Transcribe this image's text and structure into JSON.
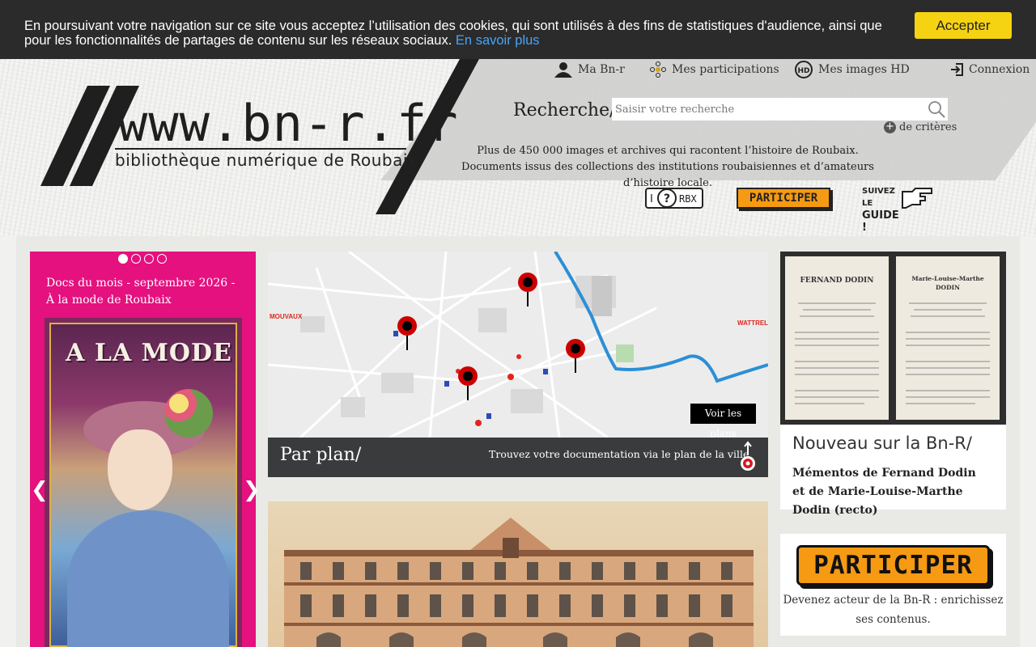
{
  "cookie": {
    "text": "En poursuivant votre navigation sur ce site vous acceptez l’utilisation des cookies, qui sont utilisés à des fins de statistiques d'audience, ainsi que pour les fonctionnalités de partages de contenu sur les réseaux sociaux.",
    "link": "En savoir plus",
    "accept": "Accepter"
  },
  "logo": {
    "title": "www.bn-r.fr",
    "subtitle": "bibliothèque numérique de Roubaix"
  },
  "topnav": {
    "ma_bnr": "Ma Bn-r",
    "participations": "Mes participations",
    "images_hd": "Mes images HD",
    "connexion": "Connexion"
  },
  "search": {
    "label": "Recherche/",
    "placeholder": "Saisir votre recherche",
    "criteria": "de critères"
  },
  "tagline": {
    "line1": "Plus de 450 000 images et archives qui racontent l’histoire de Roubaix.",
    "line2": "Documents issus des collections des institutions roubaisiennes et d’amateurs d’histoire locale."
  },
  "badges": {
    "rbx": "RBX",
    "participer": "PARTICIPER",
    "guide_line1": "SUIVEZ LE",
    "guide_line2": "GUIDE !"
  },
  "slider": {
    "title": "Docs du mois - septembre 2026 - À la mode de Roubaix",
    "poster_title": "A LA MODE",
    "dots": 4,
    "active_dot": 0
  },
  "map": {
    "label_left": "MOUVAUX",
    "label_right": "WATTRELO",
    "voir_plans": "Voir les plans",
    "bar_title": "Par plan/",
    "bar_text": "Trouvez votre documentation via le plan de la ville"
  },
  "nouveau": {
    "title": "Nouveau sur la Bn-R/",
    "description": "Mémentos de Fernand Dodin et de Marie-Louise-Marthe Dodin (recto)",
    "memento_left_name": "FERNAND DODIN",
    "memento_right_name": "Marie-Louise-Marthe DODIN"
  },
  "participer": {
    "label": "PARTICIPER",
    "text": "Devenez acteur de la Bn-R : enrichissez ses contenus."
  },
  "colors": {
    "accent_yellow": "#f5d313",
    "participer_orange": "#f59a12",
    "slider_pink": "#e4117f",
    "dark": "#3a3b3d"
  }
}
